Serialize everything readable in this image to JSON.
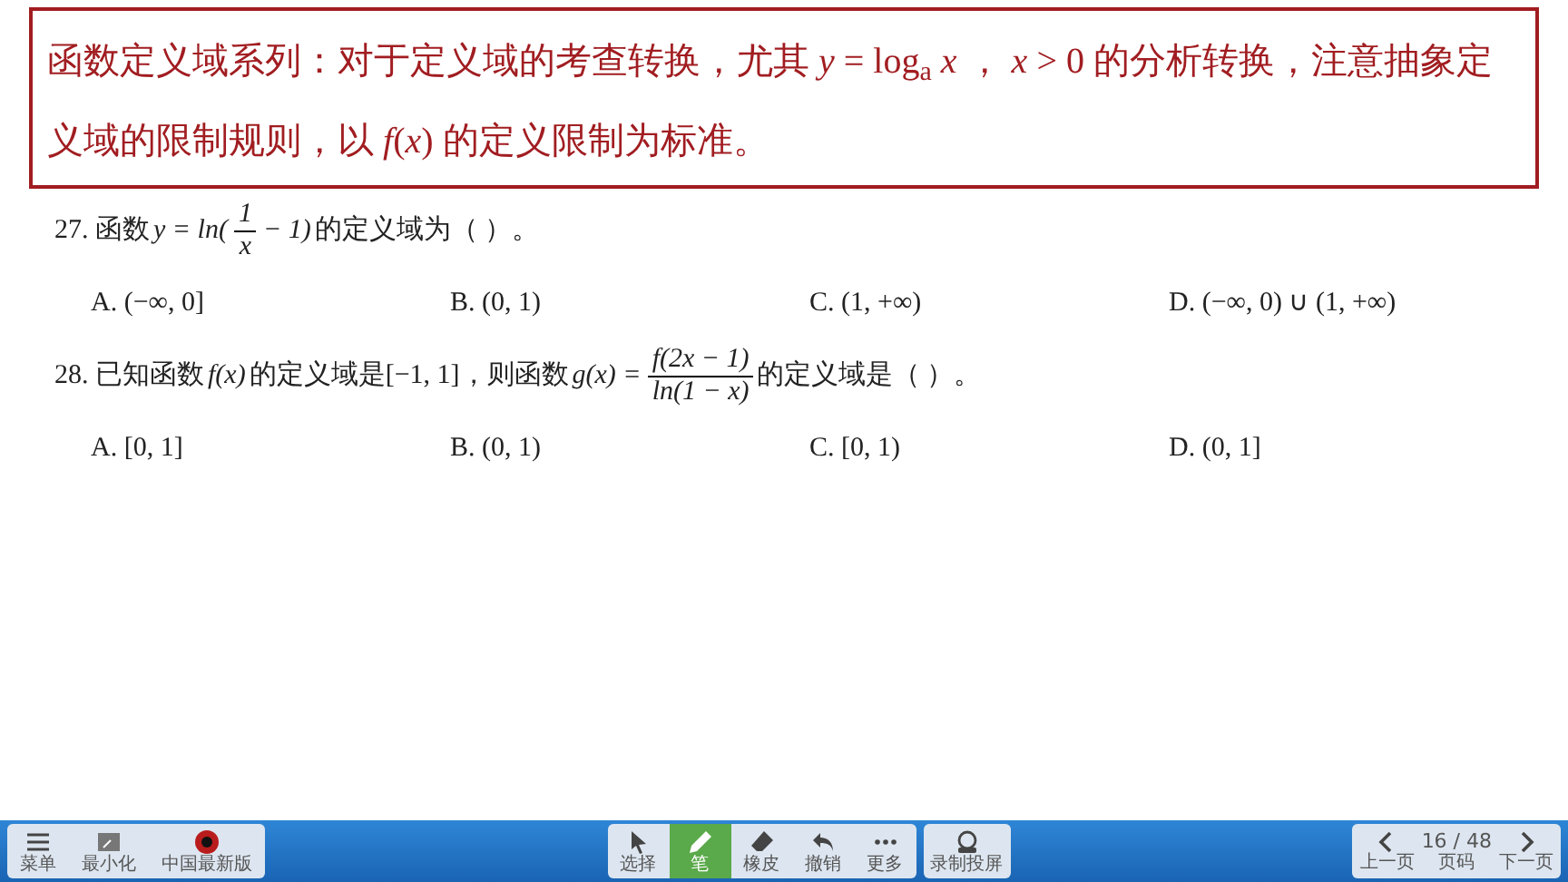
{
  "header": {
    "text": "函数定义域系列：对于定义域的考查转换，尤其 *y* = log$_{a}$ *x* ， *x* > 0 的分析转换，注意抽象定义域的限制规则，以 *f*(*x*) 的定义限制为标准。"
  },
  "questions": [
    {
      "parts": [
        {
          "kind": "text",
          "text": "27. 函数"
        },
        {
          "kind": "math",
          "text": "y = ln("
        },
        {
          "kind": "frac",
          "num": "1",
          "den": "x"
        },
        {
          "kind": "math",
          "text": "− 1)"
        },
        {
          "kind": "text",
          "text": "的定义域为（ ）。"
        }
      ],
      "options": [
        "A. (−∞, 0]",
        "B. (0, 1)",
        "C. (1, +∞)",
        "D. (−∞, 0) ∪ (1, +∞)"
      ]
    },
    {
      "parts": [
        {
          "kind": "text",
          "text": "28. 已知函数"
        },
        {
          "kind": "math",
          "text": "f(x)"
        },
        {
          "kind": "text",
          "text": "的定义域是[−1, 1]，则函数"
        },
        {
          "kind": "math",
          "text": "g(x) ="
        },
        {
          "kind": "frac",
          "num": "f(2x − 1)",
          "den": "ln(1 − x)"
        },
        {
          "kind": "text",
          "text": "的定义域是（ ）。"
        }
      ],
      "options": [
        "A. [0, 1]",
        "B. (0, 1)",
        "C. [0, 1)",
        "D. (0, 1]"
      ]
    }
  ],
  "toolbar": {
    "left": [
      {
        "kind": "menu",
        "label": "菜单"
      },
      {
        "kind": "minimize",
        "label": "最小化"
      },
      {
        "kind": "logo",
        "label": "中国最新版"
      }
    ],
    "tools": [
      {
        "kind": "select",
        "label": "选择",
        "selected": false
      },
      {
        "kind": "pen",
        "label": "笔",
        "selected": true
      },
      {
        "kind": "eraser",
        "label": "橡皮",
        "selected": false
      },
      {
        "kind": "undo",
        "label": "撤销",
        "selected": false
      },
      {
        "kind": "more",
        "label": "更多",
        "selected": false
      }
    ],
    "record": {
      "label": "录制投屏"
    },
    "pager": {
      "prev": "上一页",
      "page": "16 / 48",
      "page_label": "页码",
      "next": "下一页"
    }
  }
}
